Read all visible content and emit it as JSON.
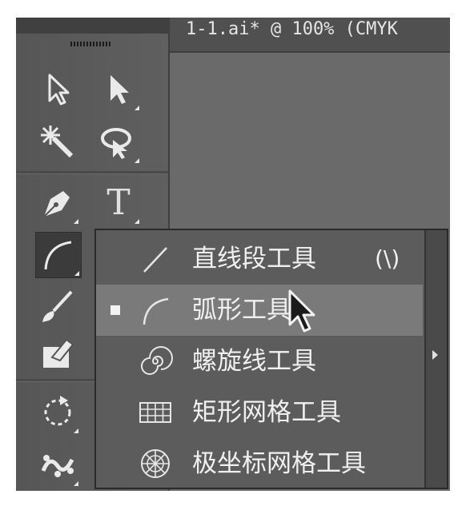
{
  "document": {
    "title": "1-1.ai* @ 100% (CMYK"
  },
  "toolbar": {
    "tools": [
      {
        "name": "selection-tool",
        "icon": "selection-arrow-icon"
      },
      {
        "name": "direct-selection-tool",
        "icon": "direct-selection-arrow-icon"
      },
      {
        "name": "magic-wand-tool",
        "icon": "magic-wand-icon"
      },
      {
        "name": "lasso-tool",
        "icon": "lasso-icon"
      },
      {
        "name": "pen-tool",
        "icon": "pen-nib-icon"
      },
      {
        "name": "type-tool",
        "icon": "type-icon",
        "glyph": "T"
      },
      {
        "name": "arc-tool",
        "icon": "arc-icon",
        "active": true
      },
      {
        "name": "paintbrush-tool",
        "icon": "paintbrush-icon"
      },
      {
        "name": "shaper-tool",
        "icon": "shaper-eraser-icon"
      },
      {
        "name": "rotate-tool",
        "icon": "rotate-icon"
      },
      {
        "name": "puppet-warp-tool",
        "icon": "puppet-warp-icon"
      }
    ]
  },
  "flyout": {
    "items": [
      {
        "label": "直线段工具",
        "shortcut": "(\\)",
        "icon": "line-segment-icon",
        "selected": false,
        "hover": false
      },
      {
        "label": "弧形工具",
        "shortcut": "",
        "icon": "arc-icon",
        "selected": true,
        "hover": true
      },
      {
        "label": "螺旋线工具",
        "shortcut": "",
        "icon": "spiral-icon",
        "selected": false,
        "hover": false
      },
      {
        "label": "矩形网格工具",
        "shortcut": "",
        "icon": "rectangular-grid-icon",
        "selected": false,
        "hover": false
      },
      {
        "label": "极坐标网格工具",
        "shortcut": "",
        "icon": "polar-grid-icon",
        "selected": false,
        "hover": false
      }
    ]
  },
  "colors": {
    "panel": "#5b5b5b",
    "menu": "#5c5c5c",
    "hover": "#7a7a7a",
    "text": "#f0f0f0"
  }
}
